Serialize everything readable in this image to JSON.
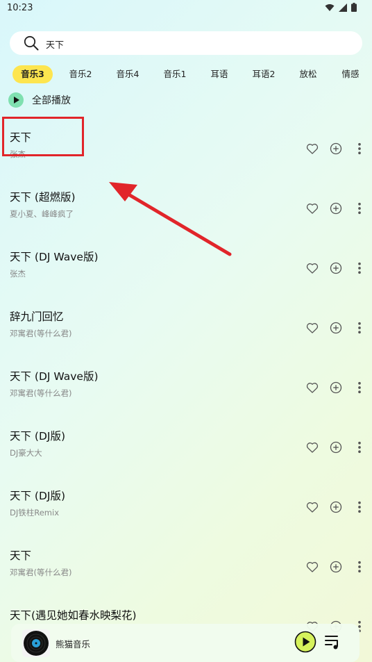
{
  "status": {
    "time": "10:23"
  },
  "search": {
    "value": "天下",
    "placeholder": ""
  },
  "tabs": [
    {
      "label": "音乐3",
      "active": true
    },
    {
      "label": "音乐2",
      "active": false
    },
    {
      "label": "音乐4",
      "active": false
    },
    {
      "label": "音乐1",
      "active": false
    },
    {
      "label": "耳语",
      "active": false
    },
    {
      "label": "耳语2",
      "active": false
    },
    {
      "label": "放松",
      "active": false
    },
    {
      "label": "情感",
      "active": false
    }
  ],
  "play_all": {
    "label": "全部播放"
  },
  "songs": [
    {
      "title": "天下",
      "artist": "张杰"
    },
    {
      "title": "天下 (超燃版)",
      "artist": "夏小夏、峰峰疯了"
    },
    {
      "title": "天下 (DJ Wave版)",
      "artist": "张杰"
    },
    {
      "title": "辞九门回忆",
      "artist": "邓寓君(等什么君)"
    },
    {
      "title": "天下 (DJ Wave版)",
      "artist": "邓寓君(等什么君)"
    },
    {
      "title": "天下 (DJ版)",
      "artist": "DJ豪大大"
    },
    {
      "title": "天下 (DJ版)",
      "artist": "DJ铁柱Remix"
    },
    {
      "title": "天下",
      "artist": "邓寓君(等什么君)"
    },
    {
      "title": "天下(遇见她如春水映梨花)",
      "artist": ""
    }
  ],
  "player": {
    "name": "熊猫音乐"
  },
  "colors": {
    "tab_active": "#fde54f",
    "annotation": "#e1252a",
    "play_button": "#d6f25c"
  },
  "icons": {
    "search": "search-icon",
    "heart": "heart-icon",
    "add": "plus-circle-icon",
    "more": "more-vertical-icon",
    "play": "play-icon",
    "playlist": "playlist-icon",
    "wifi": "wifi-icon",
    "signal": "signal-icon",
    "battery": "battery-icon"
  }
}
